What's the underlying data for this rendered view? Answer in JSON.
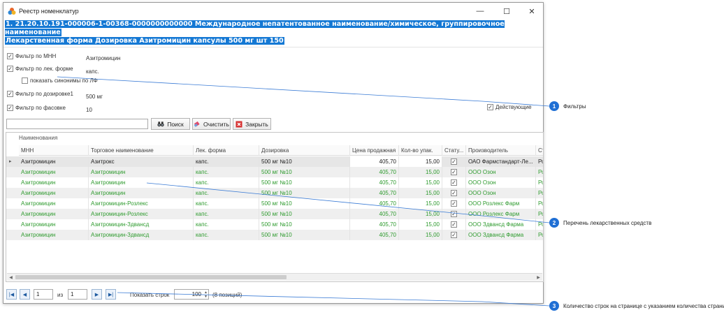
{
  "window": {
    "title": "Реестр номенклатур",
    "minimize_glyph": "—",
    "maximize_glyph": "☐",
    "close_glyph": "✕"
  },
  "header": {
    "line1": "1. 21.20.10.191-000006-1-00368-0000000000000 Международное непатентованное наименование/химическое, группировочное наименование",
    "line2": "Лекарственная форма Дозировка Азитромицин капсулы 500 мг шт 150"
  },
  "filters": {
    "mnn": {
      "label": "Фильтр по МНН",
      "value": "Азитромицин",
      "checked": true
    },
    "form": {
      "label": "Фильтр по лек. форме",
      "value": "капс.",
      "checked": true
    },
    "synonyms": {
      "label": "показать синонимы по ЛФ",
      "checked": false
    },
    "dosage": {
      "label": "Фильтр по дозировке1",
      "value": "500 мг",
      "checked": true
    },
    "package": {
      "label": "Фильтр по фасовке",
      "value": "10",
      "checked": true
    },
    "active": {
      "label": "Действующие",
      "checked": true
    }
  },
  "toolbar": {
    "search_value": "",
    "search_label": "Поиск",
    "clear_label": "Очистить",
    "close_label": "Закрыть"
  },
  "grid": {
    "caption": "Наименования",
    "columns": [
      "МНН",
      "Торговое наименование",
      "Лек. форма",
      "Дозировка",
      "Цена продажная",
      "Кол-во упак.",
      "Стату...",
      "Производитель",
      "Ст"
    ],
    "rows": [
      {
        "mnn": "Азитромицин",
        "trade": "Азитрокс",
        "form": "капс.",
        "dose": "500 мг №10",
        "price": "405,70",
        "qty": "15,00",
        "status": true,
        "maker": "ОАО Фармстандарт-Ле...",
        "st": "Ро"
      },
      {
        "mnn": "Азитромицин",
        "trade": "Азитромицин",
        "form": "капс.",
        "dose": "500 мг №10",
        "price": "405,70",
        "qty": "15,00",
        "status": true,
        "maker": "ООО Озон",
        "st": "Ро"
      },
      {
        "mnn": "Азитромицин",
        "trade": "Азитромицин",
        "form": "капс.",
        "dose": "500 мг №10",
        "price": "405,70",
        "qty": "15,00",
        "status": true,
        "maker": "ООО Озон",
        "st": "Ро"
      },
      {
        "mnn": "Азитромицин",
        "trade": "Азитромицин",
        "form": "капс.",
        "dose": "500 мг №10",
        "price": "405,70",
        "qty": "15,00",
        "status": true,
        "maker": "ООО Озон",
        "st": "Ро"
      },
      {
        "mnn": "Азитромицин",
        "trade": "Азитромицин-Розлекс",
        "form": "капс.",
        "dose": "500 мг №10",
        "price": "405,70",
        "qty": "15,00",
        "status": true,
        "maker": "ООО Розлекс Фарм",
        "st": "Ро"
      },
      {
        "mnn": "Азитромицин",
        "trade": "Азитромицин-Розлекс",
        "form": "капс.",
        "dose": "500 мг №10",
        "price": "405,70",
        "qty": "15,00",
        "status": true,
        "maker": "ООО Розлекс Фарм",
        "st": "Ро"
      },
      {
        "mnn": "Азитромицин",
        "trade": "Азитромицин-Здвансд",
        "form": "капс.",
        "dose": "500 мг №10",
        "price": "405,70",
        "qty": "15,00",
        "status": true,
        "maker": "ООО Здвансд Фарма",
        "st": "Ро"
      },
      {
        "mnn": "Азитромицин",
        "trade": "Азитромицин-Здвансд",
        "form": "капс.",
        "dose": "500 мг №10",
        "price": "405,70",
        "qty": "15,00",
        "status": true,
        "maker": "ООО Здвансд Фарма",
        "st": "Ро"
      }
    ],
    "selected_row_marker": "▸"
  },
  "pager": {
    "page": "1",
    "of_label": "из",
    "total_pages": "1",
    "show_rows_label": "Показать строк",
    "rows_per_page": "100",
    "positions": "(8 позиций)"
  },
  "callouts": [
    {
      "number": "1",
      "label": "Фильтры"
    },
    {
      "number": "2",
      "label": "Перечень лекарственных средств"
    },
    {
      "number": "3",
      "label": "Количество строк на странице с указанием количества страниц"
    }
  ],
  "colors": {
    "accent": "#1f6fd4",
    "selection": "#1478d4",
    "row_green": "#2f9b2f"
  }
}
